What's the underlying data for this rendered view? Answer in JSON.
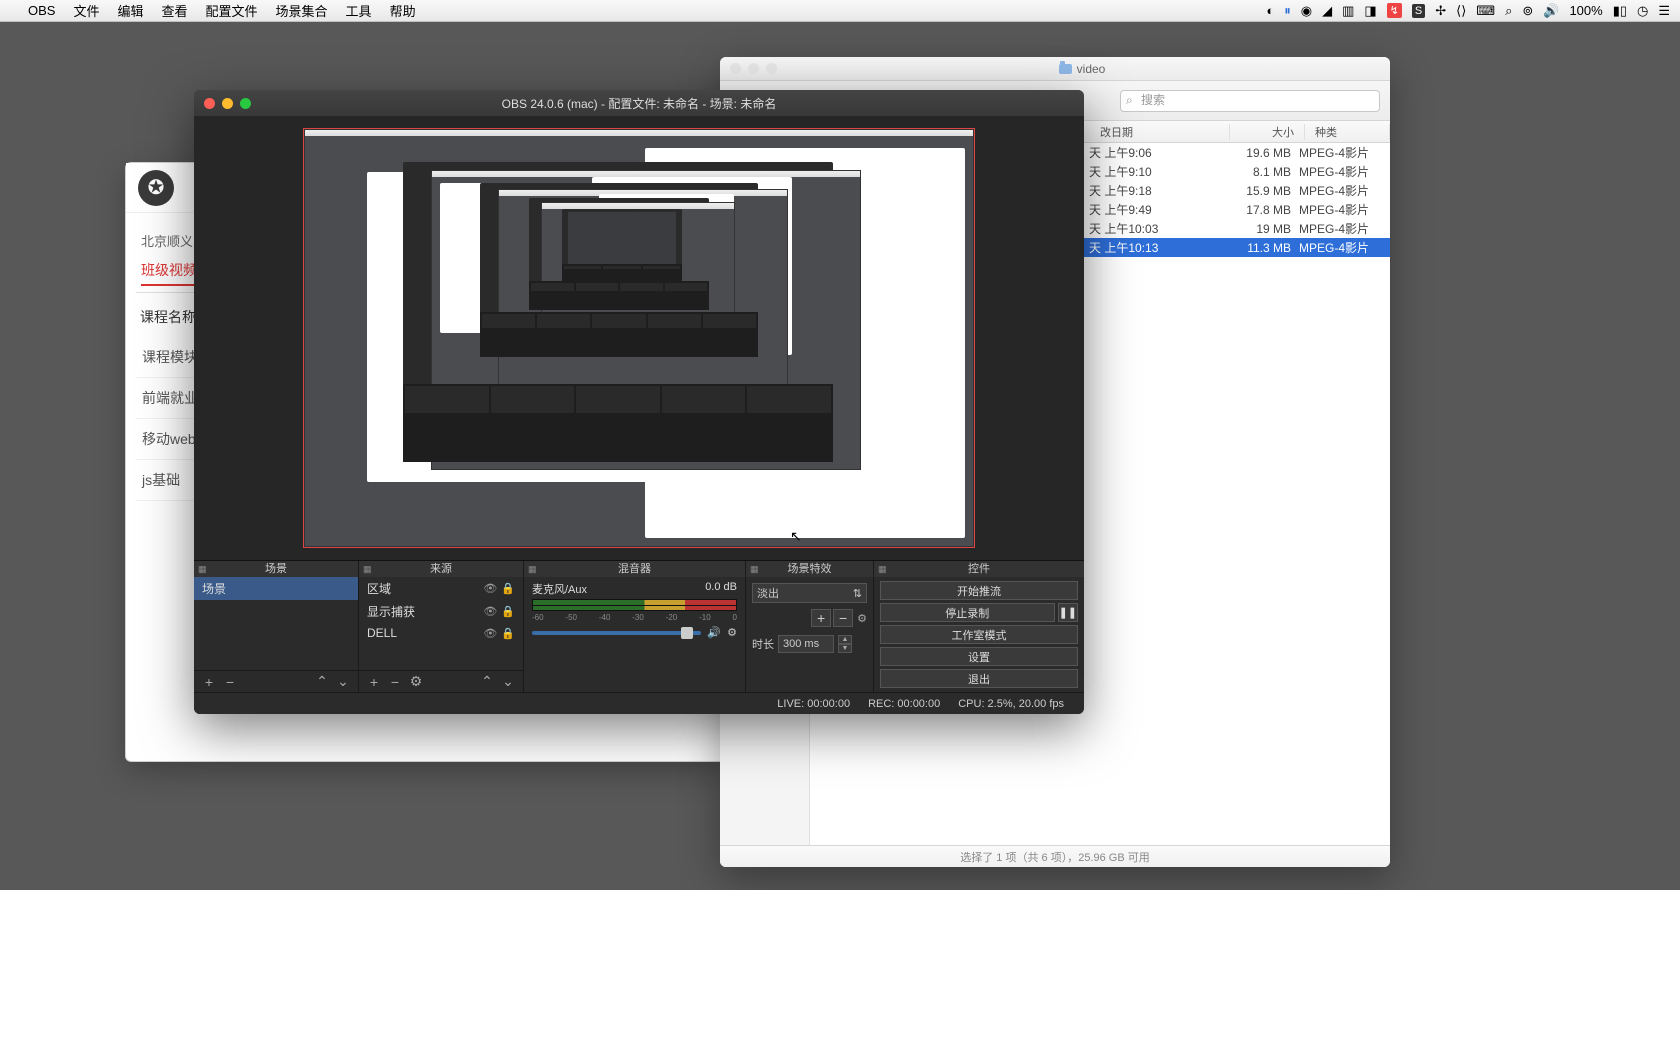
{
  "menubar": {
    "app": "OBS",
    "items": [
      "文件",
      "编辑",
      "查看",
      "配置文件",
      "场景集合",
      "工具",
      "帮助"
    ],
    "battery": "100%"
  },
  "finder": {
    "title": "video",
    "search_placeholder": "搜索",
    "cols": {
      "date": "改日期",
      "size": "大小",
      "kind": "种类"
    },
    "rows": [
      {
        "date": "天 上午9:06",
        "size": "19.6 MB",
        "kind": "MPEG-4影片"
      },
      {
        "date": "天 上午9:10",
        "size": "8.1 MB",
        "kind": "MPEG-4影片"
      },
      {
        "date": "天 上午9:18",
        "size": "15.9 MB",
        "kind": "MPEG-4影片"
      },
      {
        "date": "天 上午9:49",
        "size": "17.8 MB",
        "kind": "MPEG-4影片"
      },
      {
        "date": "天 上午10:03",
        "size": "19 MB",
        "kind": "MPEG-4影片"
      },
      {
        "date": "天 上午10:13",
        "size": "11.3 MB",
        "kind": "MPEG-4影片"
      }
    ],
    "status": "选择了 1 项（共 6 项），25.96 GB 可用"
  },
  "browser": {
    "crumb": "北京顺义",
    "active_tab": "班级视频",
    "label": "课程名称：",
    "rows": [
      "课程模块",
      "前端就业",
      "移动web",
      "js基础"
    ]
  },
  "obs": {
    "title": "OBS 24.0.6 (mac) - 配置文件: 未命名 - 场景: 未命名",
    "panels": {
      "scenes": "场景",
      "sources": "来源",
      "mixer": "混音器",
      "transitions": "场景特效",
      "controls": "控件"
    },
    "scene_item": "场景",
    "sources": [
      "区域",
      "显示捕获",
      "DELL"
    ],
    "mixer": {
      "name": "麦克风/Aux",
      "db": "0.0 dB"
    },
    "transition": {
      "select": "淡出",
      "dur_label": "时长",
      "dur_value": "300 ms"
    },
    "controls": {
      "stream": "开始推流",
      "record": "停止录制",
      "studio": "工作室模式",
      "settings": "设置",
      "exit": "退出"
    },
    "status": {
      "live": "LIVE: 00:00:00",
      "rec": "REC: 00:00:00",
      "cpu": "CPU: 2.5%, 20.00 fps"
    }
  }
}
